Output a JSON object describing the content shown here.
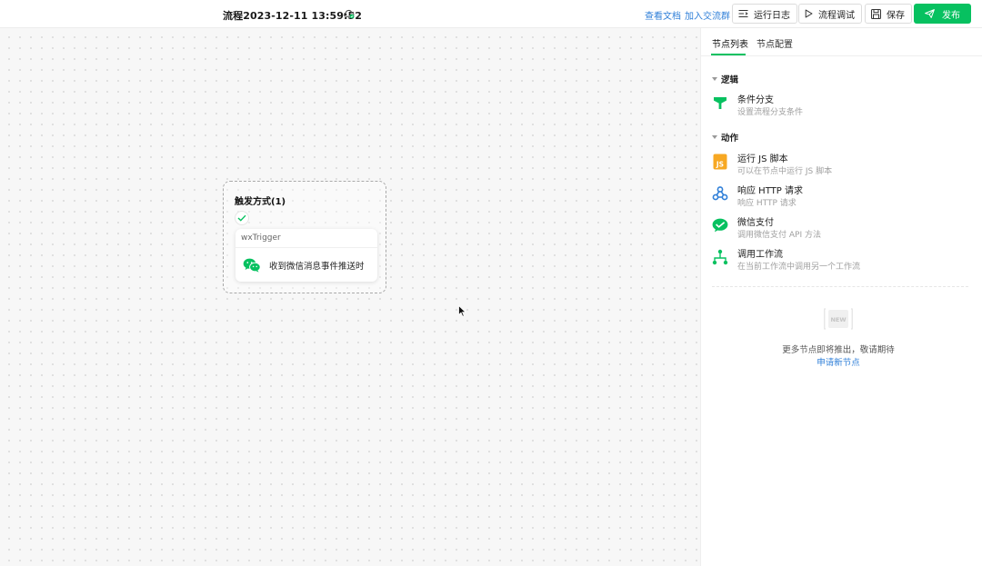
{
  "header": {
    "flow_title": "流程2023-12-11 13:59:52",
    "docs_link": "查看文档",
    "group_link": "加入交流群",
    "run_log_label": "运行日志",
    "debug_label": "流程调试",
    "save_label": "保存",
    "publish_label": "发布"
  },
  "canvas": {
    "group_title": "触发方式(1)",
    "node": {
      "type": "wxTrigger",
      "description": "收到微信消息事件推送时"
    }
  },
  "panel": {
    "tabs": [
      "节点列表",
      "节点配置"
    ],
    "active_tab": "节点列表",
    "sections": [
      {
        "title": "逻辑",
        "items": [
          {
            "name": "条件分支",
            "desc": "设置流程分支条件",
            "icon": "branch-icon"
          }
        ]
      },
      {
        "title": "动作",
        "items": [
          {
            "name": "运行 JS 脚本",
            "desc": "可以在节点中运行 JS 脚本",
            "icon": "js-icon"
          },
          {
            "name": "响应 HTTP 请求",
            "desc": "响应 HTTP 请求",
            "icon": "webhook-icon"
          },
          {
            "name": "微信支付",
            "desc": "调用微信支付 API 方法",
            "icon": "wechat-pay-icon"
          },
          {
            "name": "调用工作流",
            "desc": "在当前工作流中调用另一个工作流",
            "icon": "workflow-icon"
          }
        ]
      }
    ],
    "new_badge": "NEW",
    "more_text": "更多节点即将推出，敬请期待",
    "apply_link": "申请新节点"
  },
  "colors": {
    "brand_green": "#07c160",
    "link_blue": "#2f7fd8",
    "js_orange": "#f7a823"
  }
}
